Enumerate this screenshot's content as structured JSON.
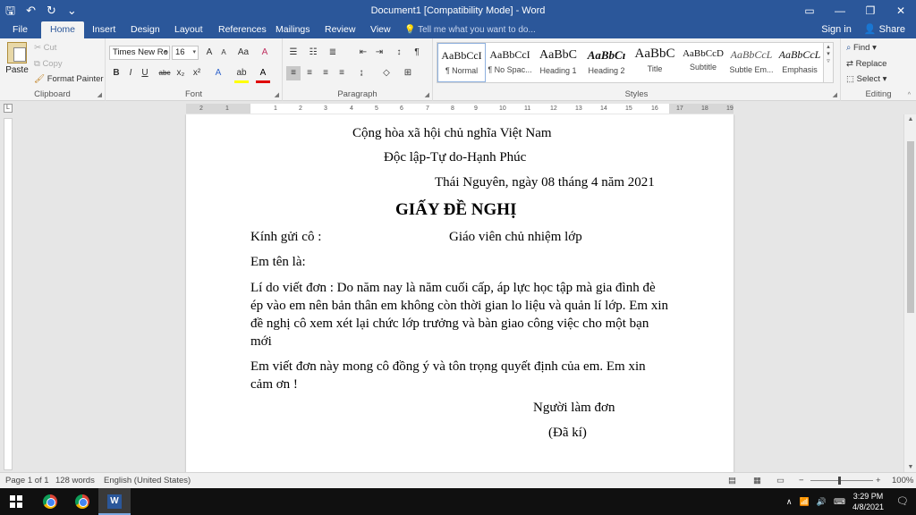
{
  "window": {
    "title": "Document1 [Compatibility Mode] - Word",
    "qat": {
      "save": "🖫",
      "undo": "↶",
      "redo": "↻",
      "customize": "⌄"
    },
    "controls": {
      "ribbon_display": "▭",
      "minimize": "—",
      "restore": "❐",
      "close": "✕"
    }
  },
  "tabs": [
    {
      "label": "File"
    },
    {
      "label": "Home"
    },
    {
      "label": "Insert"
    },
    {
      "label": "Design"
    },
    {
      "label": "Layout"
    },
    {
      "label": "References"
    },
    {
      "label": "Mailings"
    },
    {
      "label": "Review"
    },
    {
      "label": "View"
    }
  ],
  "tell_me": "Tell me what you want to do...",
  "account": {
    "sign_in": "Sign in",
    "share": "Share"
  },
  "ribbon": {
    "clipboard": {
      "label": "Clipboard",
      "paste": "Paste",
      "cut": "Cut",
      "copy": "Copy",
      "format_painter": "Format Painter"
    },
    "font": {
      "label": "Font",
      "name": "Times New Ro",
      "size": "16",
      "bold": "B",
      "italic": "I",
      "underline": "U",
      "strike": "abc",
      "subscript": "x₂",
      "superscript": "x²",
      "grow": "A",
      "shrink": "A",
      "case": "Aa",
      "clear": "A"
    },
    "paragraph": {
      "label": "Paragraph"
    },
    "styles": {
      "label": "Styles",
      "items": [
        {
          "sample": "AaBbCcI",
          "name": "¶ Normal"
        },
        {
          "sample": "AaBbCcI",
          "name": "¶ No Spac..."
        },
        {
          "sample": "AaBbC",
          "name": "Heading 1"
        },
        {
          "sample": "AaBbCı",
          "name": "Heading 2"
        },
        {
          "sample": "AaBbC",
          "name": "Title"
        },
        {
          "sample": "AaBbCcD",
          "name": "Subtitle"
        },
        {
          "sample": "AaBbCcL",
          "name": "Subtle Em..."
        },
        {
          "sample": "AaBbCcL",
          "name": "Emphasis"
        }
      ]
    },
    "editing": {
      "label": "Editing",
      "find": "Find",
      "replace": "Replace",
      "select": "Select"
    }
  },
  "ruler": {
    "numbers": [
      "2",
      "1",
      "1",
      "2",
      "3",
      "4",
      "5",
      "6",
      "7",
      "8",
      "9",
      "10",
      "11",
      "12",
      "13",
      "14",
      "15",
      "16",
      "17",
      "18",
      "19"
    ]
  },
  "document": {
    "line1": "Cộng hòa xã hội chủ nghĩa Việt Nam",
    "line2": "Độc lập-Tự do-Hạnh Phúc",
    "date": "Thái Nguyên, ngày 08 tháng 4 năm 2021",
    "title": "GIẤY ĐỀ NGHỊ",
    "to_label": "Kính gửi cô :",
    "to_value": "Giáo viên chủ nhiệm lớp",
    "name_label": "Em tên là:",
    "reason": "Lí do viết đơn : Do năm nay là năm cuối cấp, áp lực học tập mà gia đình đè ép vào em nên bản thân em không còn thời gian lo liệu và quản lí lớp. Em xin đề nghị cô xem xét lại chức lớp trưởng và bàn giao công việc cho một bạn mới",
    "closing": "Em viết đơn này mong cô đồng ý và tôn trọng quyết định của em. Em xin cảm ơn !",
    "signer": "Người làm đơn",
    "signed": "(Đã kí)"
  },
  "status": {
    "page": "Page 1 of 1",
    "words": "128 words",
    "language": "English (United States)",
    "zoom": "100%"
  },
  "taskbar": {
    "time": "3:29 PM",
    "date": "4/8/2021"
  }
}
